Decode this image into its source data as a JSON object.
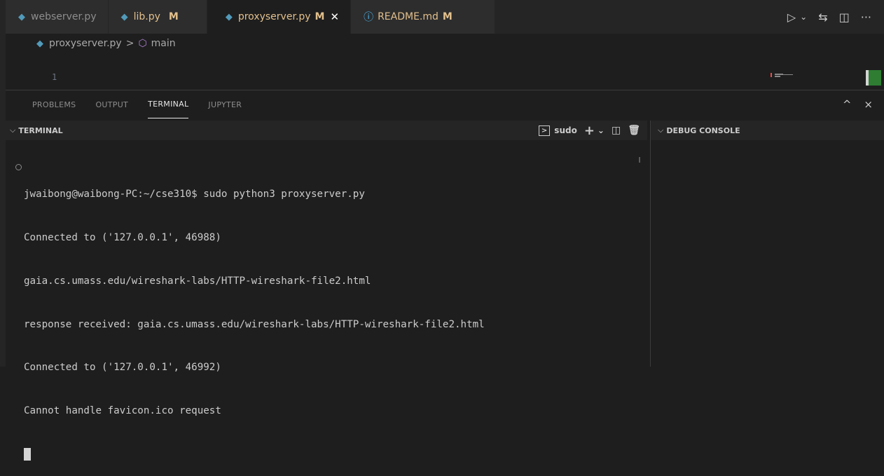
{
  "tabs": [
    {
      "label": "webserver.py",
      "modified": "",
      "active": false
    },
    {
      "label": "lib.py",
      "modified": "M",
      "active": false
    },
    {
      "label": "proxyserver.py",
      "modified": "M",
      "active": true
    },
    {
      "label": "README.md",
      "modified": "M",
      "active": false
    }
  ],
  "tab_actions": {
    "run": "▷",
    "run_menu": "⌄",
    "compare": "⇆",
    "split": "◫",
    "more": "···"
  },
  "breadcrumb": {
    "file": "proxyserver.py",
    "separator": ">",
    "symbol": "main"
  },
  "editor": {
    "line_number": "1"
  },
  "panel": {
    "tabs": [
      "PROBLEMS",
      "OUTPUT",
      "TERMINAL",
      "JUPYTER"
    ],
    "active_tab": "TERMINAL",
    "maximize": "^",
    "close": "×"
  },
  "terminal": {
    "header": "TERMINAL",
    "shell_name": "sudo",
    "lines": [
      "jwaibong@waibong-PC:~/cse310$ sudo python3 proxyserver.py",
      "Connected to ('127.0.0.1', 46988)",
      "gaia.cs.umass.edu/wireshark-labs/HTTP-wireshark-file2.html",
      "response received: gaia.cs.umass.edu/wireshark-labs/HTTP-wireshark-file2.html",
      "Connected to ('127.0.0.1', 46992)",
      "Cannot handle favicon.ico request"
    ]
  },
  "debug_console": {
    "header": "DEBUG CONSOLE"
  }
}
